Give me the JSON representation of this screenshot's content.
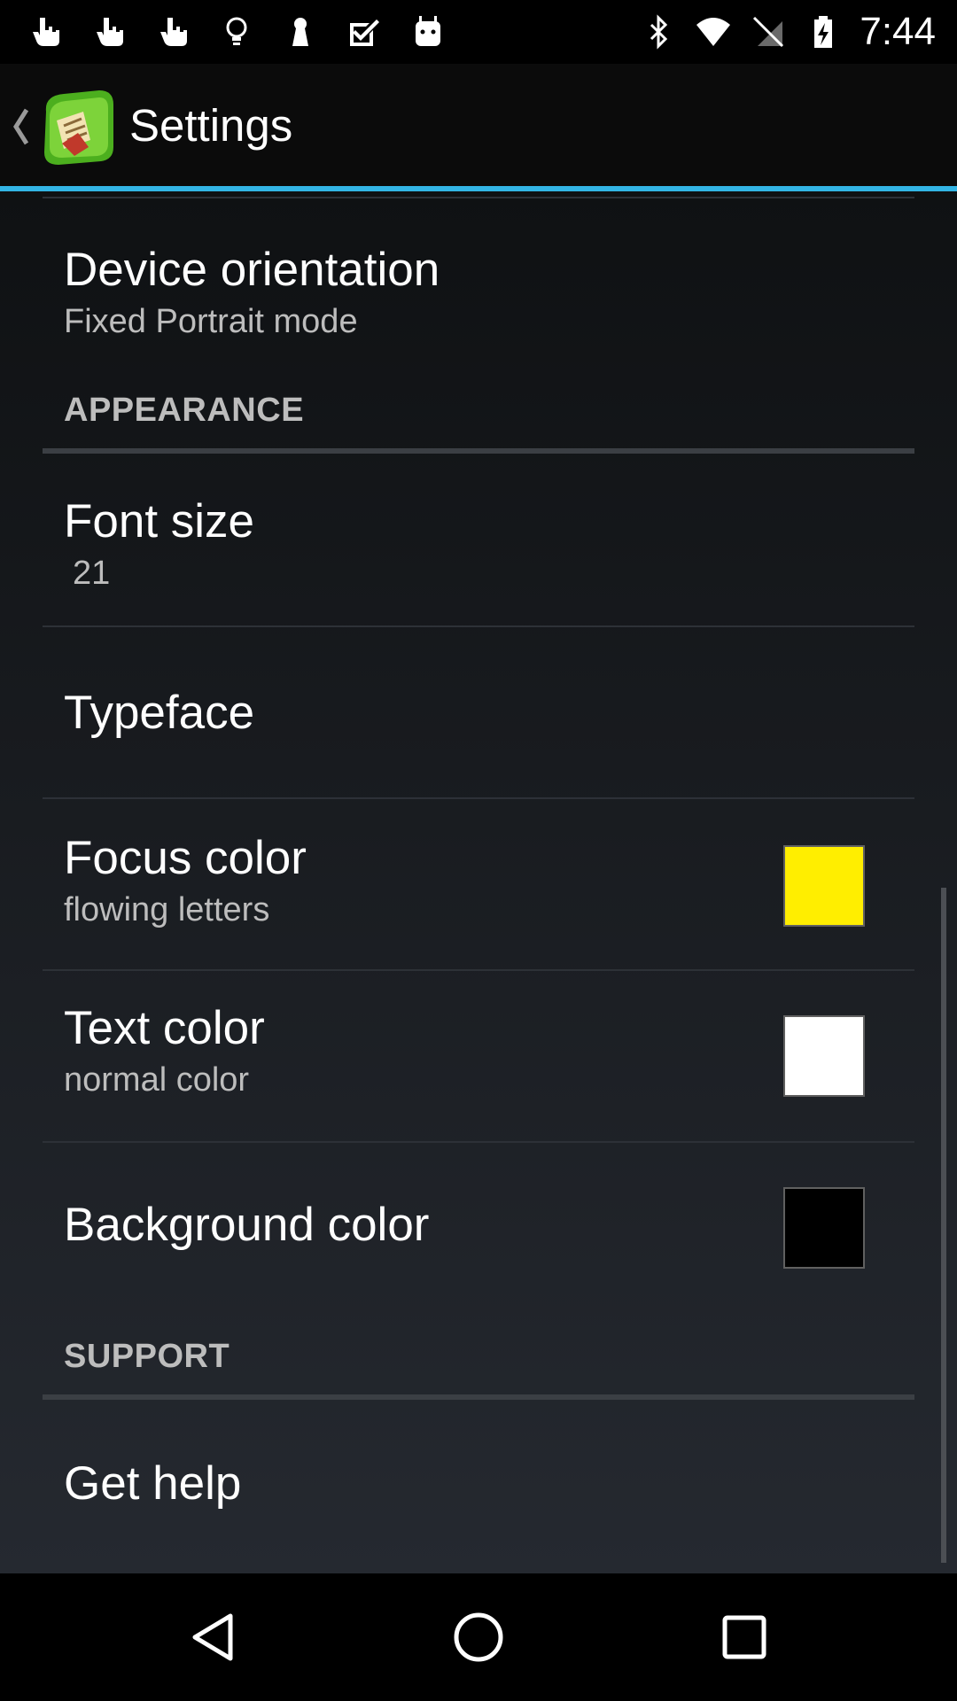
{
  "status_bar": {
    "time": "7:44",
    "left_icons": [
      "touch-icon",
      "touch-icon",
      "touch-icon",
      "lightbulb-icon",
      "keyhole-icon",
      "checkmark-box-icon",
      "android-icon"
    ],
    "right_icons": [
      "bluetooth-icon",
      "wifi-icon",
      "no-sim-icon",
      "battery-charging-icon"
    ]
  },
  "action_bar": {
    "title": "Settings",
    "accent_color": "#33b5e5"
  },
  "preferences": {
    "device_orientation": {
      "title": "Device orientation",
      "summary": "Fixed Portrait mode"
    },
    "appearance_header": "APPEARANCE",
    "font_size": {
      "title": "Font size",
      "summary": "21"
    },
    "typeface": {
      "title": "Typeface"
    },
    "focus_color": {
      "title": "Focus color",
      "summary": "flowing letters",
      "swatch": "#ffee00"
    },
    "text_color": {
      "title": "Text color",
      "summary": "normal color",
      "swatch": "#ffffff"
    },
    "background_color": {
      "title": "Background color",
      "swatch": "#000000"
    },
    "support_header": "SUPPORT",
    "get_help": {
      "title": "Get help"
    }
  },
  "nav_bar": {
    "buttons": [
      "back-icon",
      "home-icon",
      "recents-icon"
    ]
  }
}
